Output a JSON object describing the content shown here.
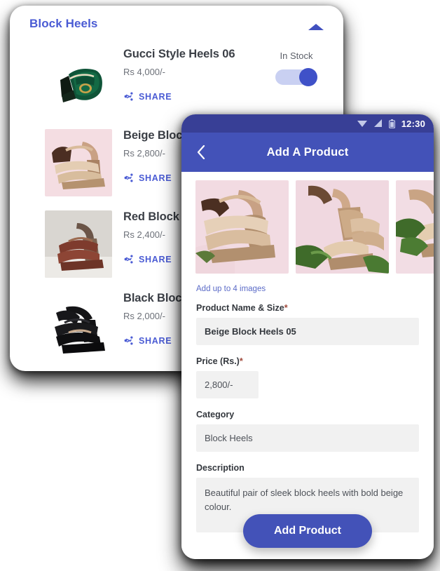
{
  "listing": {
    "title": "Block Heels",
    "collapse_icon": "caret-up-icon",
    "stock": {
      "label": "In Stock",
      "on": true
    },
    "share_label": "SHARE",
    "share_icon": "share-icon",
    "products": [
      {
        "name": "Gucci Style Heels 06",
        "price": "Rs 4,000/-",
        "share_label": "SHARE",
        "image": "green-gucci-block-heel"
      },
      {
        "name": "Beige Block",
        "price": "Rs 2,800/-",
        "share_label": "SHARE",
        "image": "beige-block-heel"
      },
      {
        "name": "Red Block H",
        "price": "Rs 2,400/-",
        "share_label": "SHARE",
        "image": "red-block-heel"
      },
      {
        "name": "Black Block",
        "price": "Rs 2,000/-",
        "share_label": "SHARE",
        "image": "black-block-heel"
      }
    ]
  },
  "phone": {
    "statusbar": {
      "time": "12:30",
      "icons": [
        "wifi-icon",
        "signal-icon",
        "battery-icon"
      ]
    },
    "appbar": {
      "back_icon": "chevron-left-icon",
      "title": "Add A Product"
    },
    "carousel": {
      "images": [
        "beige-heels-pink-1",
        "beige-heels-pink-2",
        "beige-heels-pink-3"
      ]
    },
    "form": {
      "images_hint": "Add up to 4 images",
      "fields": [
        {
          "label": "Product Name & Size",
          "required": true,
          "value": "Beige Block Heels 05"
        },
        {
          "label": "Price (Rs.)",
          "required": true,
          "value": "2,800/-"
        },
        {
          "label": "Category",
          "required": false,
          "value": "Block Heels"
        },
        {
          "label": "Description",
          "required": false,
          "value": "Beautiful pair of sleek block heels with bold beige colour."
        }
      ],
      "submit_label": "Add Product"
    }
  },
  "colors": {
    "brand_blue": "#4352b8",
    "statusbar_blue": "#383f96",
    "link_blue": "#4a5bd4",
    "required_red": "#a14a3c",
    "input_bg": "#f1f1f1"
  }
}
